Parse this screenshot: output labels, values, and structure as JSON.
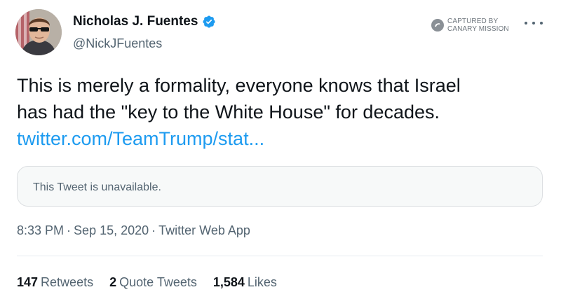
{
  "author": {
    "name": "Nicholas J. Fuentes",
    "handle": "@NickJFuentes",
    "verified": true
  },
  "watermark": {
    "line1": "CAPTURED BY",
    "line2": "CANARY MISSION"
  },
  "tweet": {
    "text_line1": "This is merely a formality, everyone knows that Israel",
    "text_line2": "has had the \"key to the White House\" for decades.",
    "link": "twitter.com/TeamTrump/stat..."
  },
  "quote": {
    "text": "This Tweet is unavailable."
  },
  "meta": {
    "time": "8:33 PM",
    "date": "Sep 15, 2020",
    "source": "Twitter Web App",
    "separator": "·"
  },
  "stats": [
    {
      "count": "147",
      "label": "Retweets"
    },
    {
      "count": "2",
      "label": "Quote Tweets"
    },
    {
      "count": "1,584",
      "label": "Likes"
    }
  ],
  "colors": {
    "link": "#1d9bf0",
    "verified": "#1d9bf0",
    "muted_text": "#536471"
  },
  "icons": [
    "verified-badge-icon",
    "canary-mission-logo",
    "more-options-icon"
  ]
}
